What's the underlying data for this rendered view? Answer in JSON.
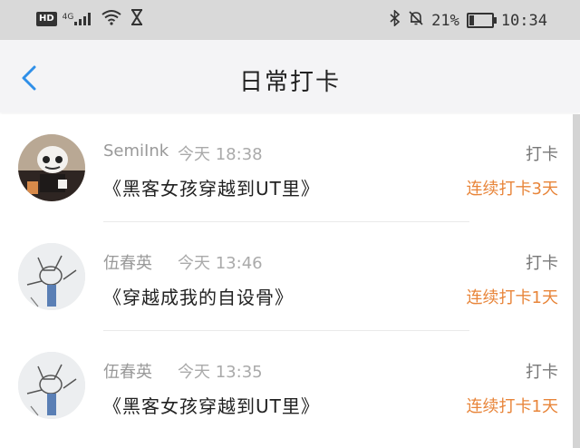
{
  "status_bar": {
    "hd": "HD",
    "network": "4G",
    "battery_percent": "21%",
    "battery_level": 0.21,
    "time": "10:34"
  },
  "header": {
    "title": "日常打卡"
  },
  "items": [
    {
      "user": "SemiInk",
      "time": "今天 18:38",
      "type": "打卡",
      "book": "《黑客女孩穿越到UT里》",
      "streak": "连续打卡3天"
    },
    {
      "user": "伍春英",
      "time": "今天 13:46",
      "type": "打卡",
      "book": "《穿越成我的自设骨》",
      "streak": "连续打卡1天"
    },
    {
      "user": "伍春英",
      "time": "今天 13:35",
      "type": "打卡",
      "book": "《黑客女孩穿越到UT里》",
      "streak": "连续打卡1天"
    }
  ],
  "colors": {
    "accent_blue": "#2f8fe8",
    "streak_orange": "#e8853a"
  }
}
